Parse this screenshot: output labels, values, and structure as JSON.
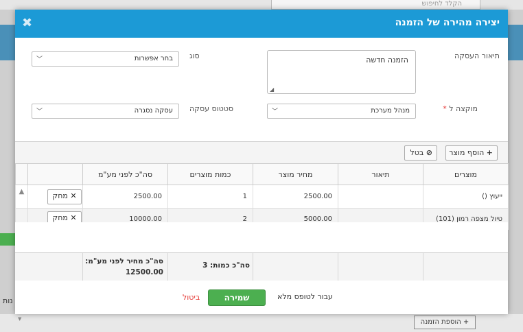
{
  "background": {
    "search_placeholder": "הקלד לחיפוש",
    "add_order_label": "הוספת הזמנה",
    "tab_fragment": "נות"
  },
  "dialog": {
    "title": "יצירה מהירה של הזמנה",
    "close_icon": "close-icon",
    "header_color": "#1c9ad6"
  },
  "form": {
    "deal_description_label": "תיאור העסקה",
    "deal_description_value": "הזמנה חדשה",
    "type_label": "סוג",
    "type_value": "בחר אפשרות",
    "assigned_to_label": "מוקצה ל",
    "assigned_to_required": "*",
    "assigned_to_value": "מנהל מערכת",
    "deal_status_label": "סטטוס עסקה",
    "deal_status_value": "עסקה נסגרה"
  },
  "toolbar": {
    "add_product_label": "הוסף מוצר",
    "cancel_label": "בטל"
  },
  "table": {
    "headers": {
      "products": "מוצרים",
      "description": "תיאור",
      "price": "מחיר מוצר",
      "quantity": "כמות מוצרים",
      "subtotal": "סה\"כ לפני מע\"מ"
    },
    "rows": [
      {
        "product": "ייעוץ ()",
        "description": "",
        "price": "2500.00",
        "quantity": "1",
        "subtotal": "2500.00",
        "delete_label": "מחק"
      },
      {
        "product": "טיול מצפה רמון (101)",
        "description": "",
        "price": "5000.00",
        "quantity": "2",
        "subtotal": "10000.00",
        "delete_label": "מחק"
      }
    ],
    "totals": {
      "quantity_label": "סה\"כ כמות: 3",
      "price_label": "סה\"כ מחיר לפני מע\"מ:",
      "price_value": "12500.00"
    }
  },
  "footer": {
    "save_label": "שמירה",
    "cancel_label": "ביטול",
    "full_form_label": "עבור לטופס מלא"
  }
}
